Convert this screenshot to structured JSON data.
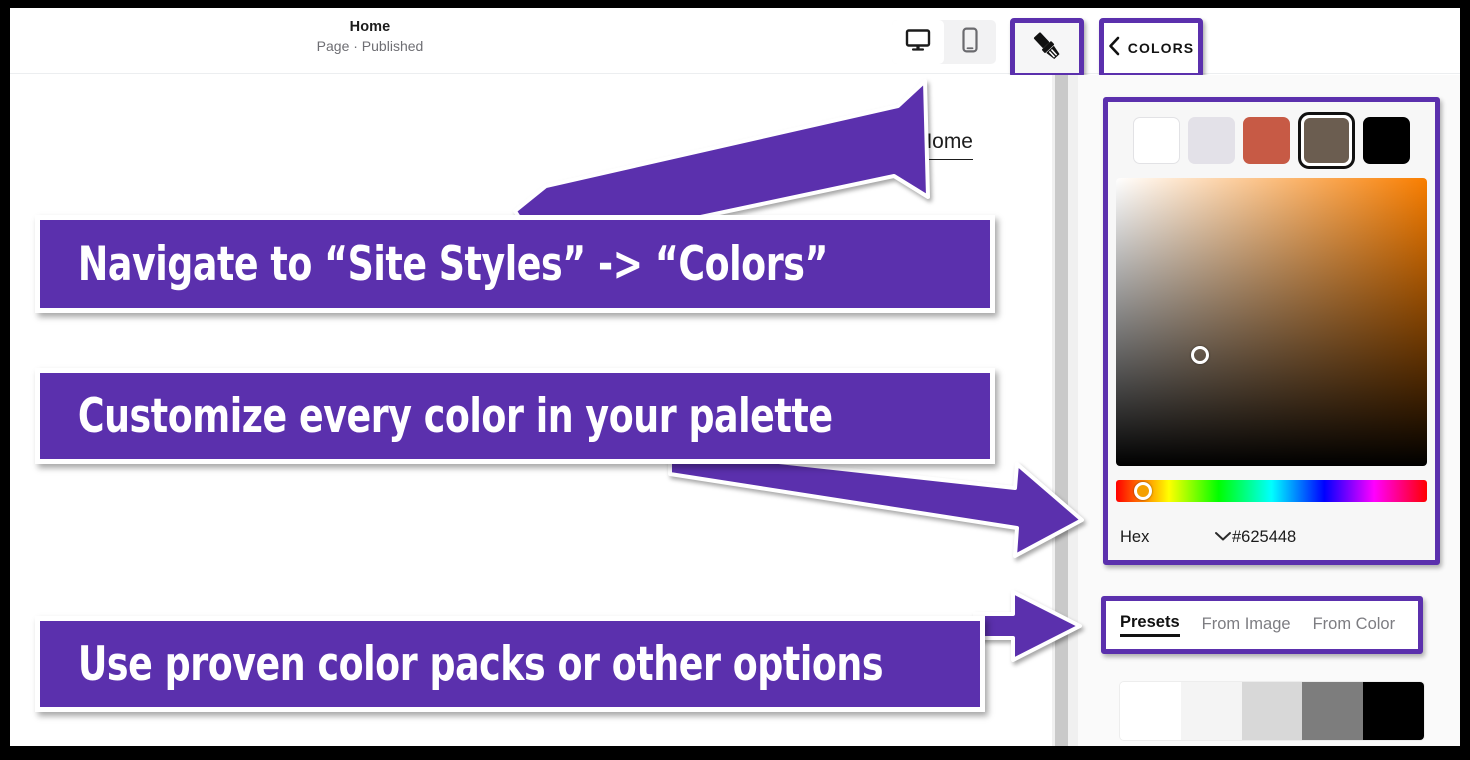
{
  "toolbar": {
    "page_title": "Home",
    "page_status": "Page · Published",
    "desktop_icon": "desktop-monitor-icon",
    "mobile_icon": "mobile-phone-icon",
    "brush_icon": "paintbrush-icon",
    "back_chevron_icon": "chevron-left-icon",
    "colors_label": "COLORS"
  },
  "canvas": {
    "nav_link": "Home"
  },
  "panel": {
    "swatches": [
      {
        "name": "white-swatch",
        "color": "#ffffff",
        "selected": false
      },
      {
        "name": "light-lavender-swatch",
        "color": "#e3e1e8",
        "selected": false
      },
      {
        "name": "terracotta-swatch",
        "color": "#c75a45",
        "selected": false
      },
      {
        "name": "brown-swatch",
        "color": "#6b5d50",
        "selected": true
      },
      {
        "name": "black-swatch",
        "color": "#000000",
        "selected": false
      }
    ],
    "picker": {
      "hue_color": "#f97e00",
      "handle_label": "saturation-value-handle",
      "hue_handle_color": "#f4a000"
    },
    "hex": {
      "mode_label": "Hex",
      "dropdown_icon": "chevron-down-icon",
      "value": "#625448"
    },
    "tabs": [
      {
        "label": "Presets",
        "active": true
      },
      {
        "label": "From Image",
        "active": false
      },
      {
        "label": "From Color",
        "active": false
      }
    ],
    "preset_strip": [
      "#ffffff",
      "#f4f4f4",
      "#d8d8d8",
      "#7d7d7d",
      "#000000"
    ]
  },
  "annotations": {
    "accent_color": "#5b30ad",
    "banners": [
      {
        "text": "Navigate to “Site Styles” -> “Colors”"
      },
      {
        "text": "Customize every color in your palette"
      },
      {
        "text": "Use proven color packs or other options"
      }
    ],
    "arrows": [
      {
        "name": "arrow-to-site-styles-button"
      },
      {
        "name": "arrow-to-hex-field"
      },
      {
        "name": "arrow-to-presets-tabs"
      }
    ]
  }
}
